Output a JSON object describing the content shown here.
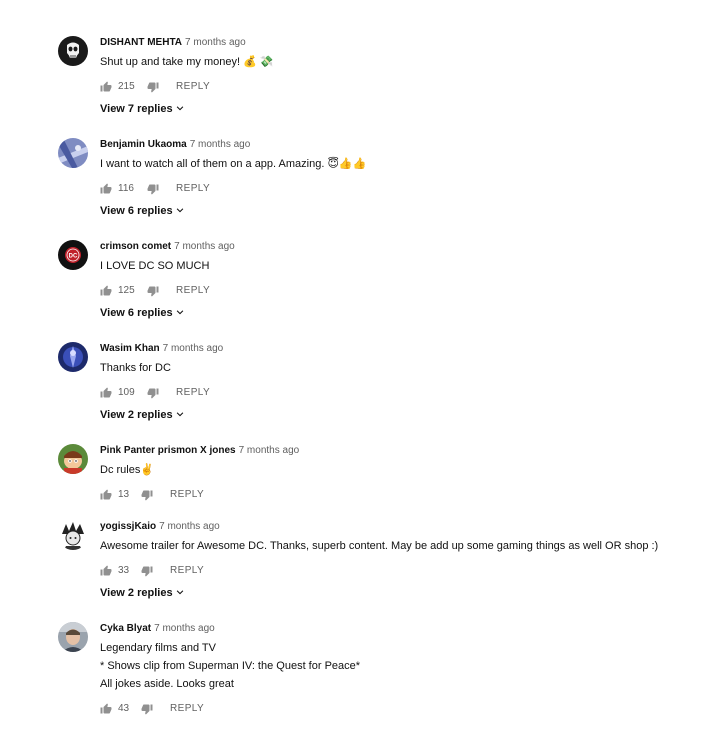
{
  "comments": [
    {
      "author": "DISHANT MEHTA",
      "time": "7 months ago",
      "avatar_icon": "punisher-skull-avatar",
      "lines": [
        "Shut up and take my money! 💰 💸"
      ],
      "likes": "215",
      "reply_label": "REPLY",
      "view_replies": "View 7 replies"
    },
    {
      "author": "Benjamin Ukaoma",
      "time": "7 months ago",
      "avatar_icon": "blue-abstract-avatar",
      "lines": [
        "I want to watch all of them on a app. Amazing. 😇👍👍"
      ],
      "likes": "116",
      "reply_label": "REPLY",
      "view_replies": "View 6 replies"
    },
    {
      "author": "crimson comet",
      "time": "7 months ago",
      "avatar_icon": "dc-logo-avatar",
      "lines": [
        "I LOVE DC SO MUCH"
      ],
      "likes": "125",
      "reply_label": "REPLY",
      "view_replies": "View 6 replies"
    },
    {
      "author": "Wasim Khan",
      "time": "7 months ago",
      "avatar_icon": "superhero-avatar",
      "lines": [
        "Thanks for DC"
      ],
      "likes": "109",
      "reply_label": "REPLY",
      "view_replies": "View 2 replies"
    },
    {
      "author": "Pink Panter prismon X jones",
      "time": "7 months ago",
      "avatar_icon": "cartoon-character-avatar",
      "lines": [
        "Dc rules✌️"
      ],
      "likes": "13",
      "reply_label": "REPLY",
      "view_replies": ""
    },
    {
      "author": "yogissjKaio",
      "time": "7 months ago",
      "avatar_icon": "anime-character-avatar",
      "lines": [
        "Awesome trailer for Awesome DC. Thanks, superb content. May be add up some gaming things as well OR shop :)"
      ],
      "likes": "33",
      "reply_label": "REPLY",
      "view_replies": "View 2 replies"
    },
    {
      "author": "Cyka Blyat",
      "time": "7 months ago",
      "avatar_icon": "person-photo-avatar",
      "lines": [
        "Legendary films and TV",
        "* Shows clip from Superman IV: the Quest for Peace*",
        "All jokes aside. Looks great"
      ],
      "likes": "43",
      "reply_label": "REPLY",
      "view_replies": ""
    }
  ]
}
